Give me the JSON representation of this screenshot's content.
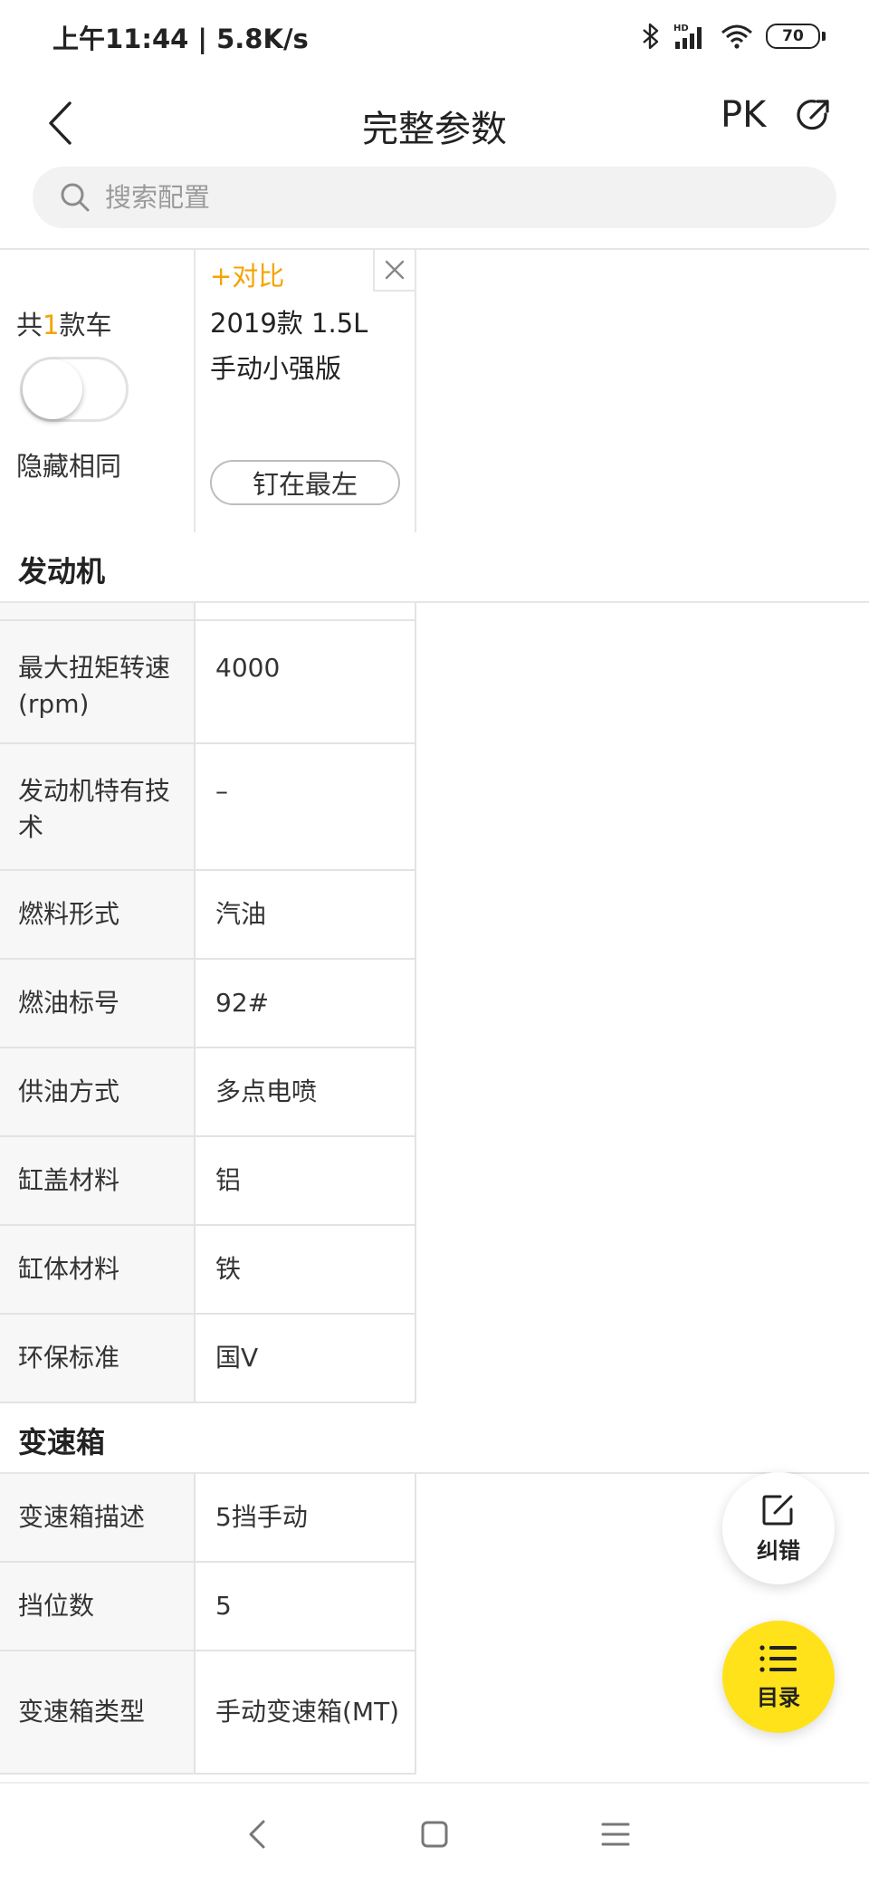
{
  "status_bar": {
    "time": "上午11:44 | 5.8K/s",
    "battery": "70",
    "icons": [
      "bluetooth-icon",
      "hd-signal-icon",
      "wifi-icon",
      "battery-icon"
    ]
  },
  "nav": {
    "title": "完整参数",
    "pk_label": "PK",
    "back_icon": "chevron-left-icon",
    "share_icon": "share-icon"
  },
  "search": {
    "placeholder": "搜索配置"
  },
  "summary": {
    "count_prefix": "共",
    "count": "1",
    "count_suffix": "款车",
    "hide_same_label": "隐藏相同",
    "hide_same_on": false
  },
  "car": {
    "compare_label": "+对比",
    "name": "2019款 1.5L 手动小强版",
    "pin_label": "钉在最左"
  },
  "sections": [
    {
      "title": "发动机",
      "rows": [
        {
          "name": "最大扭矩转速(rpm)",
          "value": "4000"
        },
        {
          "name": "发动机特有技术",
          "value": "–"
        },
        {
          "name": "燃料形式",
          "value": "汽油"
        },
        {
          "name": "燃油标号",
          "value": "92#"
        },
        {
          "name": "供油方式",
          "value": "多点电喷"
        },
        {
          "name": "缸盖材料",
          "value": "铝"
        },
        {
          "name": "缸体材料",
          "value": "铁"
        },
        {
          "name": "环保标准",
          "value": "国V"
        }
      ]
    },
    {
      "title": "变速箱",
      "rows": [
        {
          "name": "变速箱描述",
          "value": "5挡手动"
        },
        {
          "name": "挡位数",
          "value": "5"
        },
        {
          "name": "变速箱类型",
          "value": "手动变速箱(MT)"
        }
      ]
    }
  ],
  "fabs": {
    "correct_label": "纠错",
    "catalog_label": "目录"
  },
  "colors": {
    "accent": "#f5a300",
    "catalog_fab": "#ffe21a",
    "label_bg": "#f7f7f7"
  }
}
